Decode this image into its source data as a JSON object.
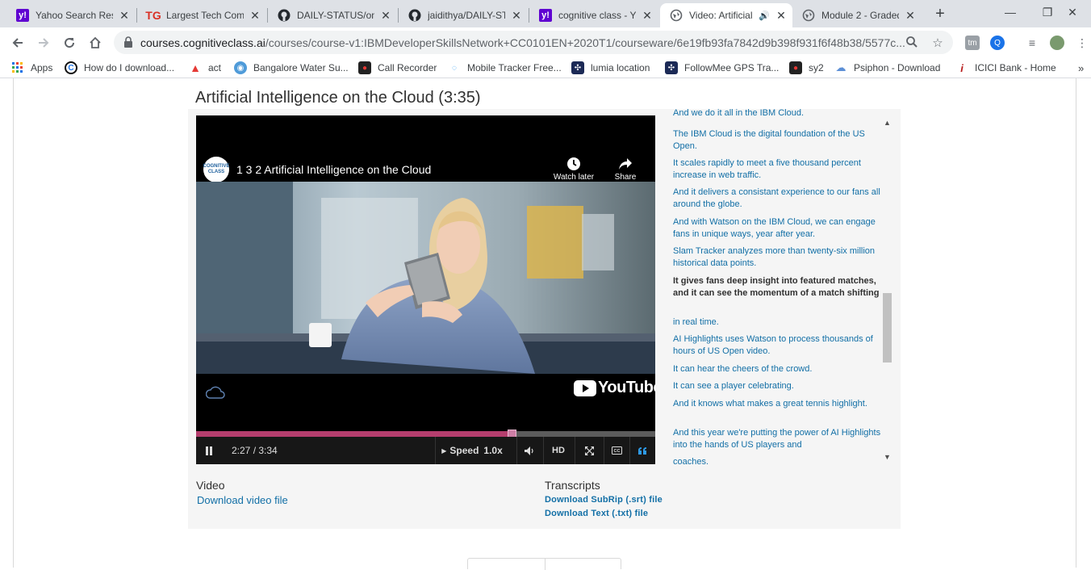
{
  "tabs": [
    {
      "title": "Yahoo Search Results",
      "icon": "yahoo-icon",
      "active": false
    },
    {
      "title": "Largest Tech Companies",
      "icon": "tg-icon",
      "active": false
    },
    {
      "title": "DAILY-STATUS/onl",
      "icon": "github-icon",
      "active": false
    },
    {
      "title": "jaidithya/DAILY-STATUS",
      "icon": "github-icon",
      "active": false
    },
    {
      "title": "cognitive class - Yahoo",
      "icon": "yahoo-icon",
      "active": false
    },
    {
      "title": "Video: Artificial",
      "icon": "globe-icon",
      "active": true,
      "audio": true
    },
    {
      "title": "Module 2 - Graded",
      "icon": "globe-icon",
      "active": false
    }
  ],
  "address": {
    "domain": "courses.cognitiveclass.ai",
    "path": "/courses/course-v1:IBMDeveloperSkillsNetwork+CC0101EN+2020T1/courseware/6e19fb93fa7842d9b398f931f6f48b38/5577c..."
  },
  "bookmarks": [
    {
      "label": "Apps",
      "icon": "apps-grid-icon"
    },
    {
      "label": "How do I download...",
      "icon": "bookmark-icon"
    },
    {
      "label": "act",
      "icon": "act-icon"
    },
    {
      "label": "Bangalore Water Su...",
      "icon": "bookmark-icon"
    },
    {
      "label": "Call Recorder",
      "icon": "bookmark-icon"
    },
    {
      "label": "Mobile Tracker Free...",
      "icon": "bookmark-icon"
    },
    {
      "label": "lumia location",
      "icon": "bookmark-icon"
    },
    {
      "label": "FollowMee GPS Tra...",
      "icon": "bookmark-icon"
    },
    {
      "label": "sy2",
      "icon": "bookmark-icon"
    },
    {
      "label": "Psiphon - Download",
      "icon": "bookmark-icon"
    },
    {
      "label": "ICICI Bank - Home",
      "icon": "bookmark-icon"
    }
  ],
  "unit": {
    "title": "Artificial Intelligence on the Cloud (3:35)"
  },
  "player": {
    "channel_logo_text": "COGNITIVE CLASS",
    "video_title": "1 3 2 Artificial Intelligence on the Cloud",
    "watch_later": "Watch later",
    "share": "Share",
    "youtube": "YouTube",
    "time": "2:27 / 3:34",
    "speed_label": "Speed",
    "speed_value": "1.0x",
    "hd": "HD",
    "progress_fraction": 0.687
  },
  "transcript": [
    {
      "text": "And we do it all in the IBM Cloud.",
      "active": false
    },
    {
      "text": "The IBM Cloud is the digital foundation of the US Open.",
      "active": false
    },
    {
      "text": "It scales rapidly to meet a five thousand percent increase in web traffic.",
      "active": false
    },
    {
      "text": "And it delivers a consistant experience to our fans all around the globe.",
      "active": false
    },
    {
      "text": "And with Watson on the IBM Cloud, we can engage fans in unique ways, year after year.",
      "active": false
    },
    {
      "text": "Slam Tracker analyzes more than twenty-six million historical data points.",
      "active": false
    },
    {
      "text": "It gives fans deep insight into featured matches, and it can see the momentum of a match shifting",
      "active": true
    },
    {
      "text": "in real time.",
      "active": false
    },
    {
      "text": "AI Highlights uses Watson to process thousands of hours of US Open video.",
      "active": false
    },
    {
      "text": "It can hear the cheers of the crowd.",
      "active": false
    },
    {
      "text": "It can see a player celebrating.",
      "active": false
    },
    {
      "text": "And it knows what makes a great tennis highlight.",
      "active": false
    },
    {
      "text": "And this year we're putting the power of AI Highlights into the hands of US players and",
      "active": false
    },
    {
      "text": "coaches.",
      "active": false
    }
  ],
  "downloads": {
    "video_heading": "Video",
    "video_link": "Download video file",
    "transcripts_heading": "Transcripts",
    "srt_link": "Download SubRip (.srt) file",
    "txt_link": "Download Text (.txt) file"
  },
  "colors": {
    "link": "#126fa6",
    "progress": "#b53e6e"
  }
}
